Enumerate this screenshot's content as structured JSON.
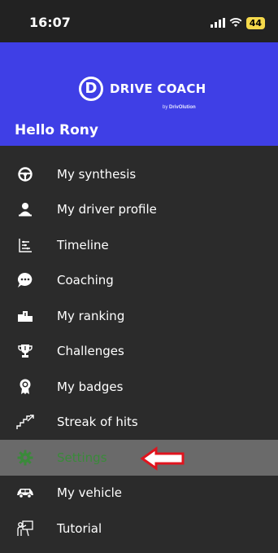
{
  "status_bar": {
    "time": "16:07",
    "battery": "44"
  },
  "header": {
    "logo_letter": "D",
    "logo_text": "DRIVE COACH",
    "logo_by_prefix": "by",
    "logo_by_brand": "DrivOlution",
    "greeting": "Hello Rony",
    "background": "#3f3fe6"
  },
  "menu": {
    "items": [
      {
        "label": "My synthesis",
        "icon": "steering-wheel-icon"
      },
      {
        "label": "My driver profile",
        "icon": "user-icon"
      },
      {
        "label": "Timeline",
        "icon": "timeline-icon"
      },
      {
        "label": "Coaching",
        "icon": "chat-bubble-icon"
      },
      {
        "label": "My ranking",
        "icon": "podium-icon"
      },
      {
        "label": "Challenges",
        "icon": "trophy-icon"
      },
      {
        "label": "My badges",
        "icon": "badge-icon"
      },
      {
        "label": "Streak of hits",
        "icon": "stairs-icon"
      },
      {
        "label": "Settings",
        "icon": "gear-icon",
        "active": true
      },
      {
        "label": "My vehicle",
        "icon": "car-icon"
      },
      {
        "label": "Tutorial",
        "icon": "teacher-board-icon"
      }
    ],
    "active_color": "#3a8a3a",
    "highlight_annotation_color": "#e0141e"
  }
}
